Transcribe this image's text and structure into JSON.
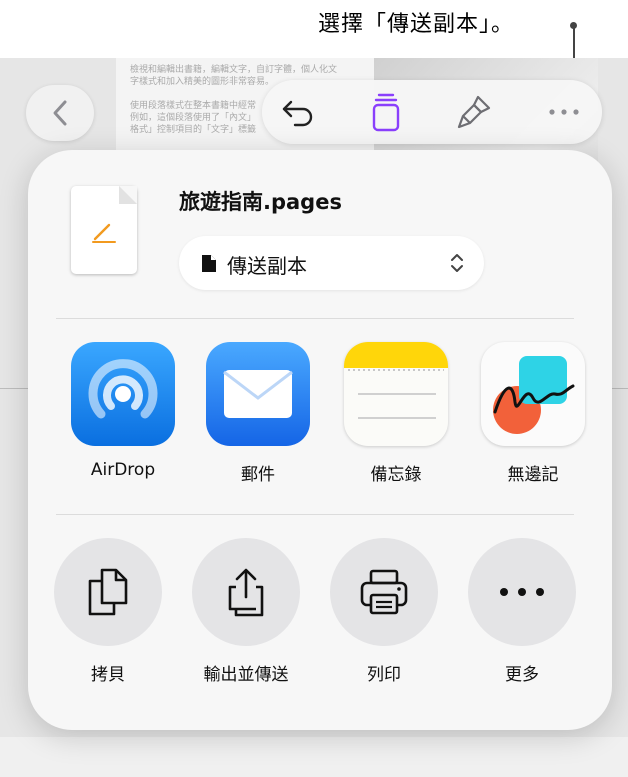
{
  "callout": {
    "text": "選擇「傳送副本」。"
  },
  "background_doc": {
    "lines": [
      "檢視和編輯出書籍，編輯文字，自訂字體，個人化文",
      "字樣式和加入精美的圖形非常容易。",
      "使用段落樣式在整本書籍中經常",
      "例如，這個段落使用了「內文」",
      "格式」控制項目的「文字」標籤"
    ]
  },
  "toolbar": {
    "back": "chevron-left-icon",
    "undo": "undo-icon",
    "pages": "page-icon",
    "format": "paintbrush-icon",
    "more": "ellipsis-icon"
  },
  "share_sheet": {
    "file_name": "旅遊指南.pages",
    "send_option": "傳送副本",
    "apps": [
      {
        "label": "AirDrop",
        "icon": "airdrop-icon"
      },
      {
        "label": "郵件",
        "icon": "mail-icon"
      },
      {
        "label": "備忘錄",
        "icon": "notes-icon"
      },
      {
        "label": "無邊記",
        "icon": "freeform-icon"
      }
    ],
    "actions": [
      {
        "label": "拷貝",
        "icon": "copy-icon"
      },
      {
        "label": "輸出並傳送",
        "icon": "export-icon"
      },
      {
        "label": "列印",
        "icon": "printer-icon"
      },
      {
        "label": "更多",
        "icon": "ellipsis-icon"
      }
    ]
  },
  "colors": {
    "accent_purple": "#8a3ffc",
    "airdrop_blue": "#1a8cff",
    "mail_blue": "#1f7cf2",
    "notes_yellow": "#ffd60a",
    "pages_orange": "#f29a1f"
  }
}
